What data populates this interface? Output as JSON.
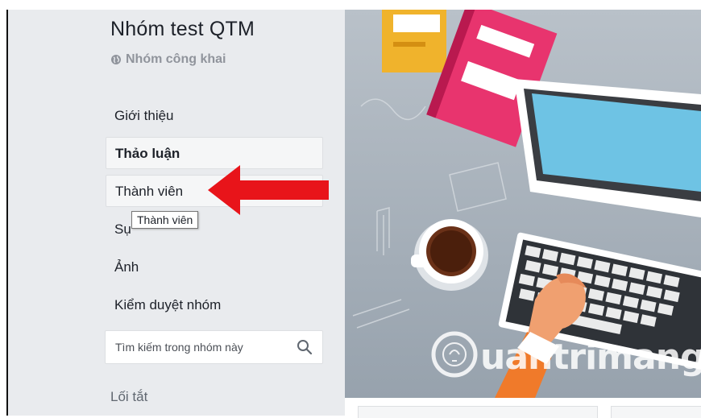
{
  "group": {
    "name": "Nhóm test QTM",
    "privacy": "Nhóm công khai"
  },
  "nav": {
    "items": [
      {
        "label": "Giới thiệu"
      },
      {
        "label": "Thảo luận"
      },
      {
        "label": "Thành viên"
      },
      {
        "label": "Sự kiện"
      },
      {
        "label": "Ảnh"
      },
      {
        "label": "Kiểm duyệt nhóm"
      }
    ],
    "tooltip": "Thành viên",
    "partial_label": "Sụ"
  },
  "search": {
    "placeholder": "Tìm kiếm trong nhóm này"
  },
  "shortcuts": {
    "label": "Lối tắt"
  },
  "cover": {
    "watermark": "uantrimang"
  },
  "colors": {
    "sidebar_bg": "#e9ebee",
    "arrow": "#e8141a",
    "text": "#1d2129",
    "muted": "#90949c"
  }
}
